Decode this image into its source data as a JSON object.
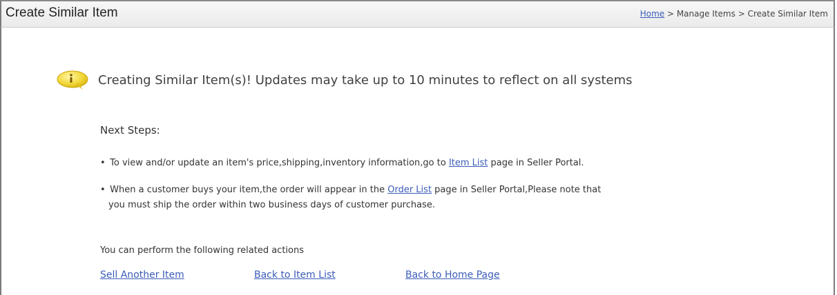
{
  "header": {
    "title": "Create Similar Item",
    "breadcrumb": {
      "home": "Home",
      "separator": " > ",
      "manage": "Manage Items",
      "current": "Create Similar Item"
    }
  },
  "message": {
    "icon": "info-bubble-icon",
    "icon_color": "#f2d83a",
    "text": "Creating Similar Item(s)! Updates may take up to 10 minutes to reflect on all systems"
  },
  "next_steps": {
    "heading": "Next Steps:",
    "step1": {
      "bullet": "•",
      "before": " To view and/or update an item's price,shipping,inventory information,go to ",
      "link": "Item List",
      "after": " page in Seller Portal."
    },
    "step2": {
      "bullet": "•",
      "before": " When a customer buys your item,the order will appear in the ",
      "link": "Order List",
      "after": " page in Seller Portal,Please note that",
      "continuation": "you must ship the order within two business days of customer purchase."
    }
  },
  "related": {
    "text": "You can perform the following related actions",
    "actions": [
      "Sell Another Item",
      "Back to Item List",
      "Back to Home Page"
    ]
  },
  "colors": {
    "link": "#3b5cb8",
    "header_bg": "#efefef",
    "text": "#333333"
  }
}
